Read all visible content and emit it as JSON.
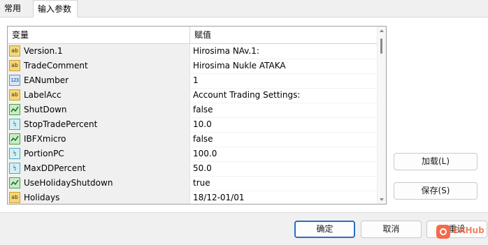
{
  "tabs": [
    {
      "label": "常用"
    },
    {
      "label": "输入参数"
    }
  ],
  "grid": {
    "headers": {
      "variable": "变量",
      "value": "赋值"
    },
    "rows": [
      {
        "icon": "string-type-icon",
        "icon_text": "ab",
        "name": "Version.1",
        "value": "Hirosima NAv.1:"
      },
      {
        "icon": "string-type-icon",
        "icon_text": "ab",
        "name": "TradeComment",
        "value": "Hirosima Nukle ATAKA"
      },
      {
        "icon": "integer-type-icon",
        "icon_text": "123",
        "name": "EANumber",
        "value": "1"
      },
      {
        "icon": "string-type-icon",
        "icon_text": "ab",
        "name": "LabelAcc",
        "value": "Account Trading Settings:"
      },
      {
        "icon": "bool-type-icon",
        "icon_text": "",
        "name": "ShutDown",
        "value": "false"
      },
      {
        "icon": "double-type-icon",
        "icon_text": "½",
        "name": "StopTradePercent",
        "value": "10.0"
      },
      {
        "icon": "bool-type-icon",
        "icon_text": "",
        "name": "IBFXmicro",
        "value": "false"
      },
      {
        "icon": "double-type-icon",
        "icon_text": "½",
        "name": "PortionPC",
        "value": "100.0"
      },
      {
        "icon": "double-type-icon",
        "icon_text": "½",
        "name": "MaxDDPercent",
        "value": "50.0"
      },
      {
        "icon": "bool-type-icon",
        "icon_text": "",
        "name": "UseHolidayShutdown",
        "value": "true"
      },
      {
        "icon": "string-type-icon",
        "icon_text": "ab",
        "name": "Holidays",
        "value": "18/12-01/01"
      }
    ]
  },
  "side_buttons": {
    "load": "加载(L)",
    "save": "保存(S)"
  },
  "footer_buttons": {
    "ok": "确定",
    "cancel": "取消",
    "reset": "重设"
  },
  "watermark": {
    "text": "EAHub"
  }
}
